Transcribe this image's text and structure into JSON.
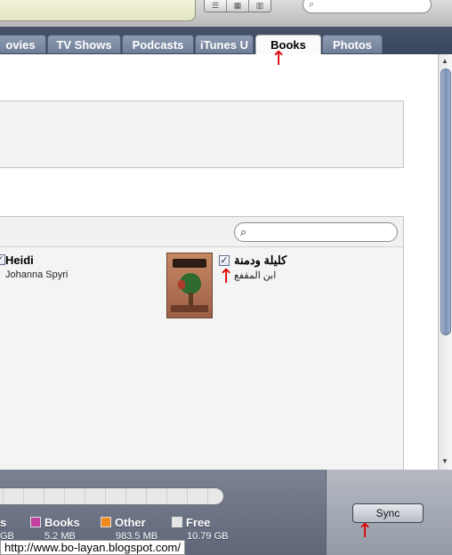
{
  "tabs": [
    {
      "label": "ovies",
      "active": false
    },
    {
      "label": "TV Shows",
      "active": false
    },
    {
      "label": "Podcasts",
      "active": false
    },
    {
      "label": "iTunes U",
      "active": false
    },
    {
      "label": "Books",
      "active": true
    },
    {
      "label": "Photos",
      "active": false
    }
  ],
  "books": [
    {
      "title": "Heidi",
      "author": "Johanna Spyri",
      "checked": true
    },
    {
      "title": "كليلة ودمنة",
      "author": "ابن المقفع",
      "checked": true
    }
  ],
  "capacity": {
    "partial_label": "s",
    "partial_size": "GB",
    "items": [
      {
        "label": "Books",
        "size": "5.2 MB",
        "color": "#c23fa4"
      },
      {
        "label": "Other",
        "size": "983.5 MB",
        "color": "#f08a1c"
      },
      {
        "label": "Free",
        "size": "10.79 GB",
        "color": "#e6e6e6"
      }
    ]
  },
  "sync_label": "Sync",
  "url_text": "http://www.bo-layan.blogspot.com/",
  "arrow_glyph": "↑",
  "icons": {
    "search": "magnifier-icon",
    "check": "✓",
    "scroll_up": "▲",
    "scroll_down": "▼"
  }
}
